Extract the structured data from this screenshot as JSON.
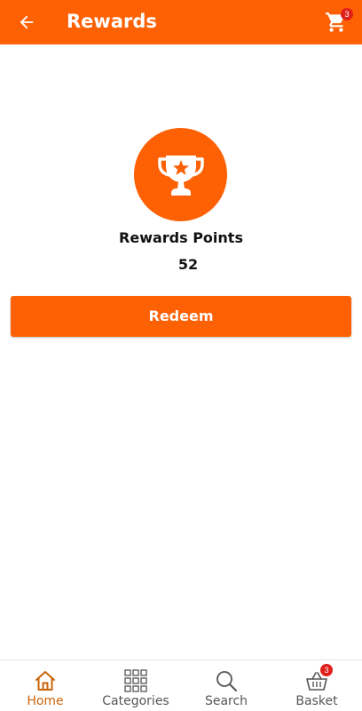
{
  "header": {
    "title": "Rewards",
    "cart_count": "3"
  },
  "rewards": {
    "label": "Rewards Points",
    "points": "52",
    "redeem_label": "Redeem"
  },
  "nav": {
    "home": "Home",
    "categories": "Categories",
    "search": "Search",
    "basket": "Basket",
    "basket_count": "3"
  },
  "colors": {
    "brand": "#fd6104",
    "badge": "#e0201b",
    "active_nav": "#c96408"
  }
}
